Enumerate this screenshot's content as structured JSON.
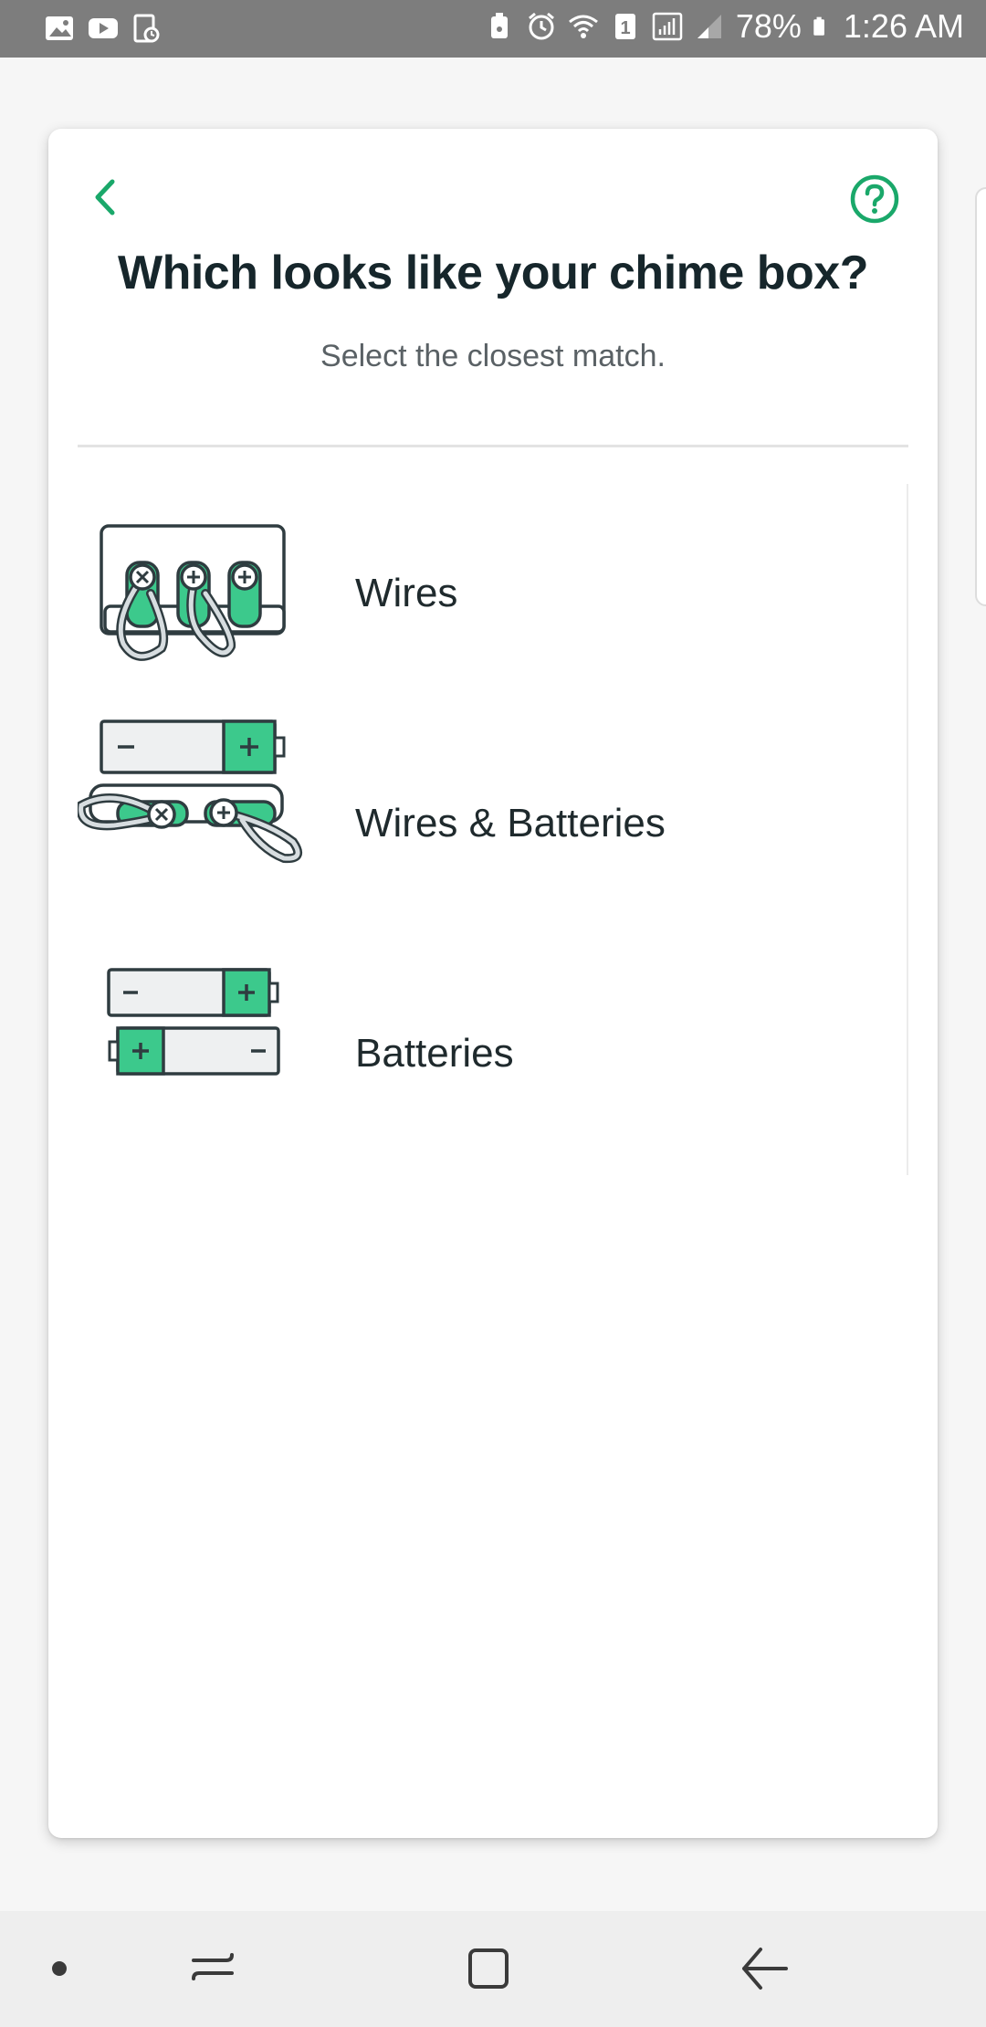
{
  "status_bar": {
    "battery_percent": "78%",
    "time": "1:26 AM",
    "left_icons": [
      "gallery-icon",
      "youtube-icon",
      "clipboard-icon"
    ],
    "right_icons": [
      "lock-icon",
      "alarm-icon",
      "wifi-icon",
      "sim1-icon",
      "signal-icon",
      "battery-icon"
    ]
  },
  "header": {
    "title": "Which looks like your chime box?",
    "subtitle": "Select the closest match."
  },
  "options": [
    {
      "label": "Wires",
      "icon": "wires-chime-icon"
    },
    {
      "label": "Wires & Batteries",
      "icon": "wires-and-batteries-chime-icon"
    },
    {
      "label": "Batteries",
      "icon": "batteries-chime-icon"
    }
  ],
  "colors": {
    "accent": "#1aa86a",
    "illustration_green": "#3cc98c",
    "outline": "#2f3c40",
    "title": "#16262b"
  },
  "nav_bar": {
    "items": [
      "dot-icon",
      "recents-icon",
      "home-icon",
      "back-icon"
    ]
  }
}
